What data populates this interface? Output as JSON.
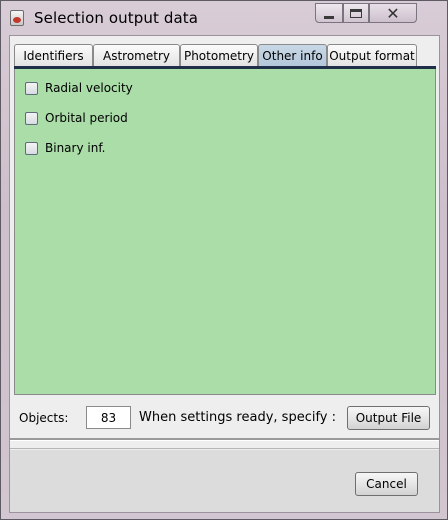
{
  "window": {
    "title": "Selection output data",
    "icon": "java-cup-icon",
    "controls": {
      "minimize": "minimize-icon",
      "maximize": "maximize-icon",
      "close": "✕"
    }
  },
  "tabs": [
    {
      "label": "Identifiers",
      "active": false
    },
    {
      "label": "Astrometry",
      "active": false
    },
    {
      "label": "Photometry",
      "active": false
    },
    {
      "label": "Other info",
      "active": true
    },
    {
      "label": "Output format",
      "active": false
    }
  ],
  "panel": {
    "background": "#aadda7",
    "options": [
      {
        "label": "Radial velocity",
        "checked": false
      },
      {
        "label": "Orbital period",
        "checked": false
      },
      {
        "label": "Binary inf.",
        "checked": false
      }
    ]
  },
  "footer": {
    "objects_label": "Objects:",
    "objects_value": "83",
    "ready_text": "When settings ready, specify :",
    "output_button": "Output File",
    "cancel_button": "Cancel"
  }
}
